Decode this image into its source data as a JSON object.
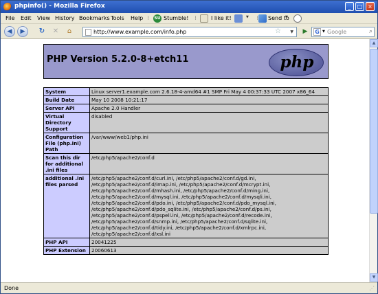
{
  "window": {
    "title": "phpinfo() - Mozilla Firefox",
    "minimize": "_",
    "maximize": "□",
    "close": "×"
  },
  "menu": {
    "items": [
      "File",
      "Edit",
      "View",
      "History",
      "Bookmarks",
      "Tools",
      "Help"
    ],
    "stumble_label": "Stumble!",
    "stumble_icon_text": "SU",
    "like_label": "I like it!",
    "sendto_label": "Send to"
  },
  "nav": {
    "back": "◀",
    "forward": "▶",
    "reload": "↻",
    "stop": "✕",
    "home": "⌂",
    "url": "http://www.example.com/info.php",
    "star": "☆",
    "go": "▶",
    "search_placeholder": "Google",
    "search_engine_letter": "G"
  },
  "php": {
    "version_title": "PHP Version 5.2.0-8+etch11",
    "logo_text": "php"
  },
  "info_rows": [
    {
      "key": "System",
      "value": "Linux server1.example.com 2.6.18-4-amd64 #1 SMP Fri May 4 00:37:33 UTC 2007 x86_64"
    },
    {
      "key": "Build Date",
      "value": "May 10 2008 10:21:17"
    },
    {
      "key": "Server API",
      "value": "Apache 2.0 Handler"
    },
    {
      "key": "Virtual Directory Support",
      "value": "disabled"
    },
    {
      "key": "Configuration File (php.ini) Path",
      "value": "/var/www/web1/php.ini"
    },
    {
      "key": "Scan this dir for additional .ini files",
      "value": "/etc/php5/apache2/conf.d"
    },
    {
      "key": "additional .ini files parsed",
      "value": "/etc/php5/apache2/conf.d/curl.ini, /etc/php5/apache2/conf.d/gd.ini, /etc/php5/apache2/conf.d/imap.ini, /etc/php5/apache2/conf.d/mcrypt.ini, /etc/php5/apache2/conf.d/mhash.ini, /etc/php5/apache2/conf.d/ming.ini, /etc/php5/apache2/conf.d/mysql.ini, /etc/php5/apache2/conf.d/mysqli.ini, /etc/php5/apache2/conf.d/pdo.ini, /etc/php5/apache2/conf.d/pdo_mysql.ini, /etc/php5/apache2/conf.d/pdo_sqlite.ini, /etc/php5/apache2/conf.d/ps.ini, /etc/php5/apache2/conf.d/pspell.ini, /etc/php5/apache2/conf.d/recode.ini, /etc/php5/apache2/conf.d/snmp.ini, /etc/php5/apache2/conf.d/sqlite.ini, /etc/php5/apache2/conf.d/tidy.ini, /etc/php5/apache2/conf.d/xmlrpc.ini, /etc/php5/apache2/conf.d/xsl.ini"
    },
    {
      "key": "PHP API",
      "value": "20041225"
    },
    {
      "key": "PHP Extension",
      "value": "20060613"
    }
  ],
  "status": {
    "text": "Done"
  },
  "colors": {
    "header_bg": "#9999cc",
    "key_bg": "#ccccff",
    "value_bg": "#cccccc",
    "titlebar": "#2a5cc4"
  },
  "icons": [
    "firefox-icon",
    "stumble-icon",
    "thumbs-up-icon",
    "thumbs-down-icon",
    "send-to-icon",
    "comment-icon",
    "back-icon",
    "forward-icon",
    "reload-icon",
    "stop-icon",
    "home-icon",
    "page-icon",
    "bookmark-star-icon",
    "go-icon",
    "google-icon",
    "search-icon"
  ]
}
